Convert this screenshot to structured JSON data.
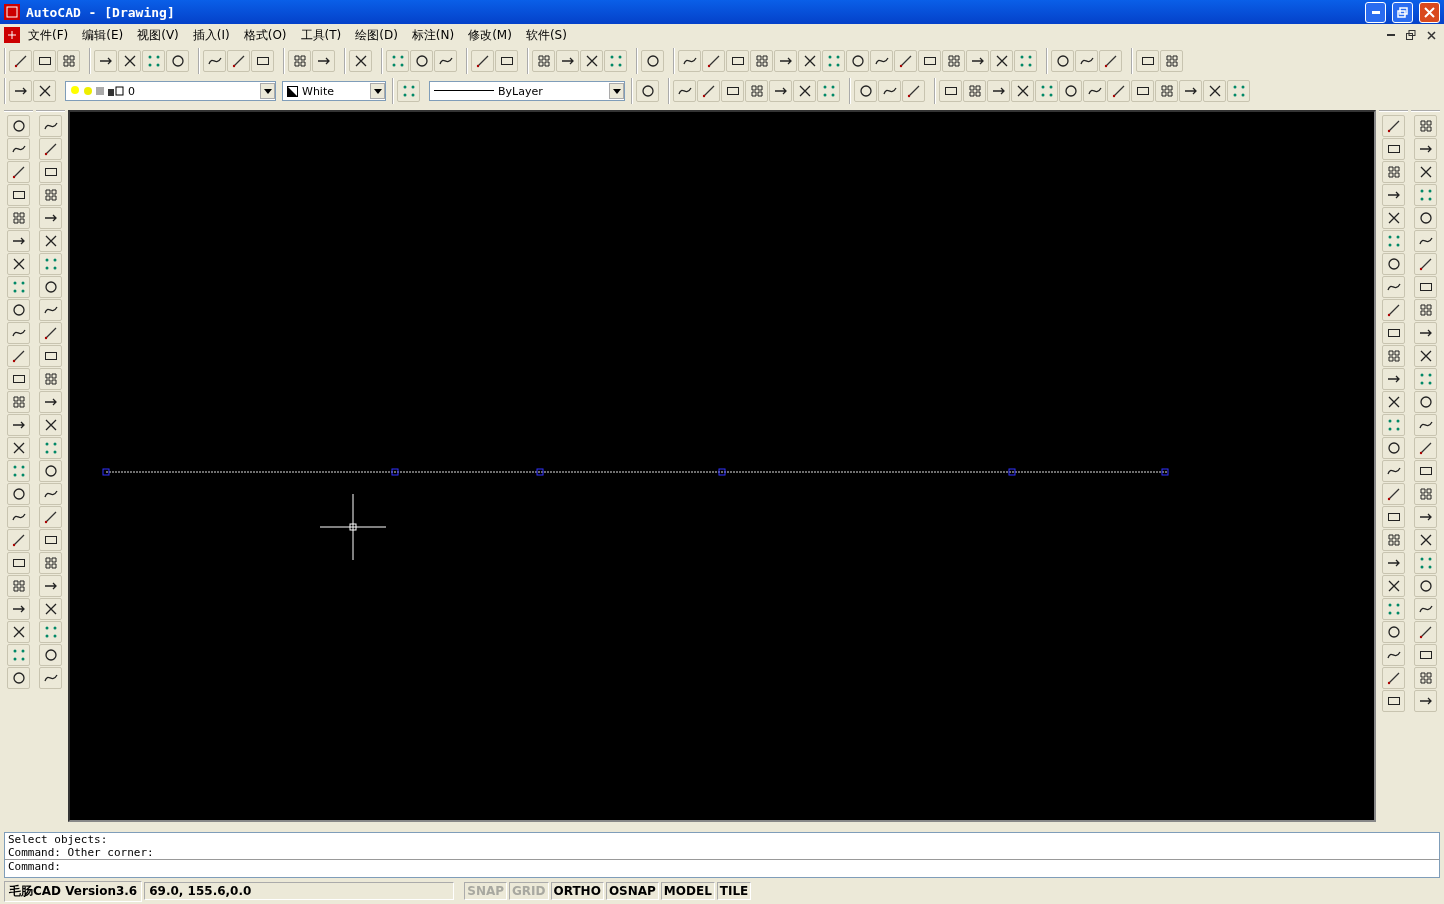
{
  "window": {
    "title": "AutoCAD - [Drawing]"
  },
  "menu": [
    {
      "label": "文件(F)"
    },
    {
      "label": "编辑(E)"
    },
    {
      "label": "视图(V)"
    },
    {
      "label": "插入(I)"
    },
    {
      "label": "格式(O)"
    },
    {
      "label": "工具(T)"
    },
    {
      "label": "绘图(D)"
    },
    {
      "label": "标注(N)"
    },
    {
      "label": "修改(M)"
    },
    {
      "label": "软件(S)"
    }
  ],
  "properties_bar": {
    "layer": "0",
    "color_name": "White",
    "linetype": "ByLayer"
  },
  "command_window": {
    "history": [
      "Select objects:",
      "Command: Other corner:"
    ],
    "prompt": "Command:"
  },
  "status_bar": {
    "app": "毛肠CAD Version3.6",
    "coordinates": "69.0, 155.6,0.0",
    "toggles": [
      {
        "label": "SNAP",
        "on": false
      },
      {
        "label": "GRID",
        "on": false
      },
      {
        "label": "ORTHO",
        "on": true
      },
      {
        "label": "OSNAP",
        "on": true
      },
      {
        "label": "MODEL",
        "on": true
      },
      {
        "label": "TILE",
        "on": true
      }
    ]
  }
}
